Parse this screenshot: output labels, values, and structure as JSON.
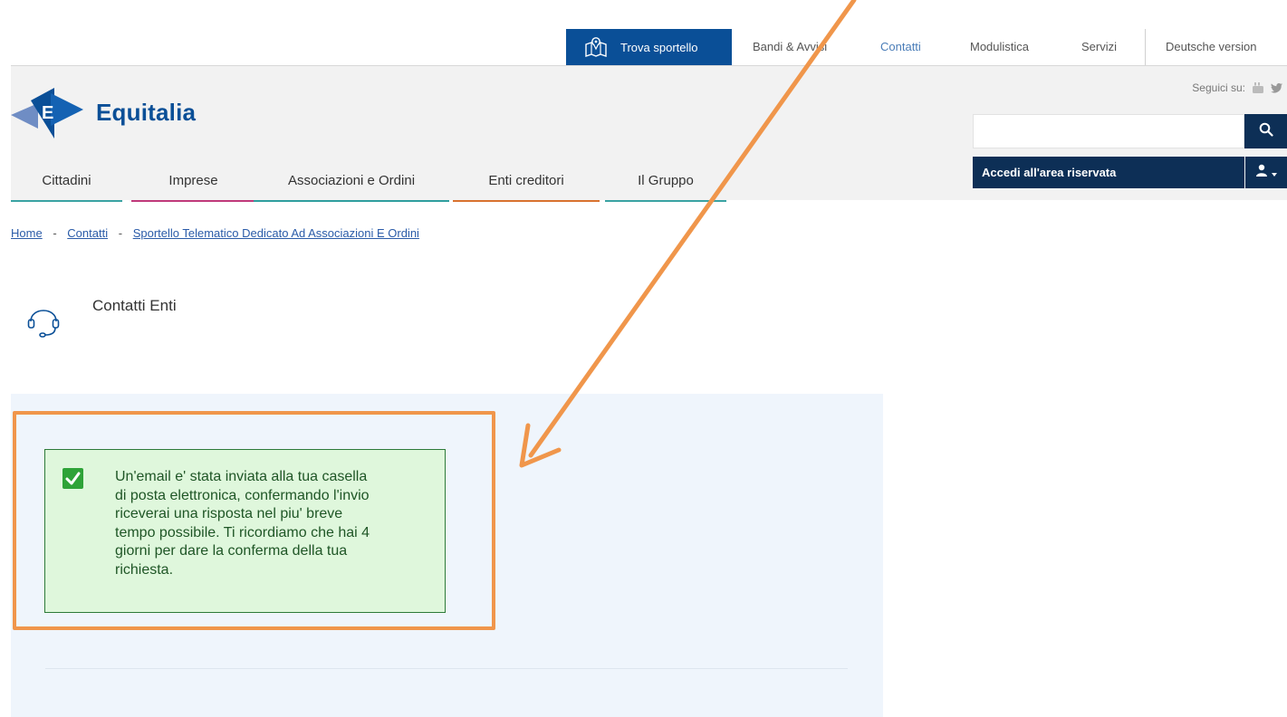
{
  "topbar": {
    "trova_label": "Trova sportello",
    "links": [
      "Bandi & Avvisi",
      "Contatti",
      "Modulistica",
      "Servizi",
      "Deutsche version"
    ]
  },
  "header": {
    "brand": "Equitalia",
    "seguici": "Seguici su:",
    "search_placeholder": "",
    "area_label": "Accedi all'area riservata"
  },
  "nav": {
    "items": [
      "Cittadini",
      "Imprese",
      "Associazioni e Ordini",
      "Enti creditori",
      "Il Gruppo"
    ],
    "colors": [
      "#3aa3a3",
      "#c0397a",
      "#2f9e9e",
      "#d9722f",
      "#3aa3a3"
    ]
  },
  "breadcrumb": {
    "items": [
      "Home",
      "Contatti",
      "Sportello Telematico Dedicato Ad Associazioni E Ordini"
    ],
    "separator": "-"
  },
  "page": {
    "title": "Contatti Enti"
  },
  "alert": {
    "message": "Un'email e' stata inviata alla tua casella\ndi posta elettronica, confermando l'invio\nriceverai una risposta nel piu' breve\ntempo possibile. Ti ricordiamo che hai 4\ngiorni per dare la conferma della tua\nrichiesta."
  },
  "colors": {
    "brand_blue": "#0a4f97",
    "dark_navy": "#0d2f56",
    "success_bg": "#dff7dc",
    "success_border": "#2d7a38",
    "annotation_orange": "#f0964b"
  },
  "icons": [
    "map-icon",
    "youtube-icon",
    "twitter-icon",
    "search-icon",
    "user-icon",
    "headset-icon",
    "checkmark-icon"
  ]
}
